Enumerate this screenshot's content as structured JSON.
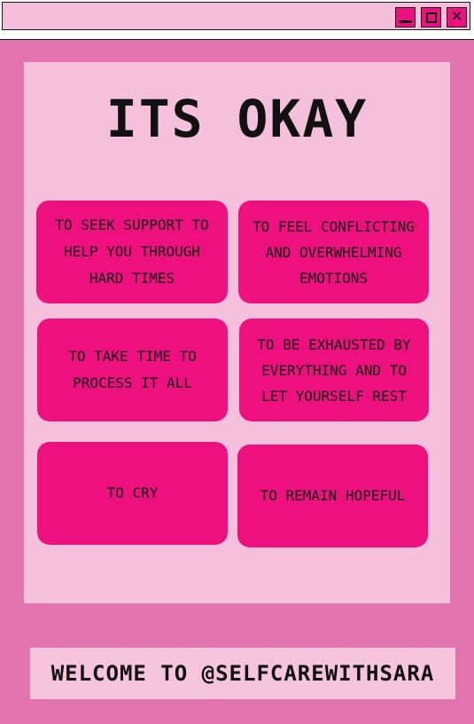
{
  "window": {
    "minimize_icon": "minimize-icon",
    "maximize_icon": "maximize-icon",
    "close_icon": "close-icon",
    "accent_color": "#ee107f"
  },
  "main": {
    "title": "ITS OKAY",
    "cards": [
      {
        "text": "TO SEEK SUPPORT TO HELP YOU THROUGH HARD TIMES"
      },
      {
        "text": "TO FEEL CONFLICTING AND OVERWHELMING EMOTIONS"
      },
      {
        "text": "TO TAKE TIME TO PROCESS IT ALL"
      },
      {
        "text": "TO BE EXHAUSTED BY EVERYTHING AND TO LET YOURSELF REST"
      },
      {
        "text": "TO CRY"
      },
      {
        "text": "TO REMAIN HOPEFUL"
      }
    ]
  },
  "footer": {
    "text": "WELCOME TO @SELFCAREWITHSARA"
  },
  "colors": {
    "frame": "#e274ae",
    "panel": "#f4c0dc",
    "card": "#ee107f",
    "titlebar": "#f4bfdb"
  }
}
